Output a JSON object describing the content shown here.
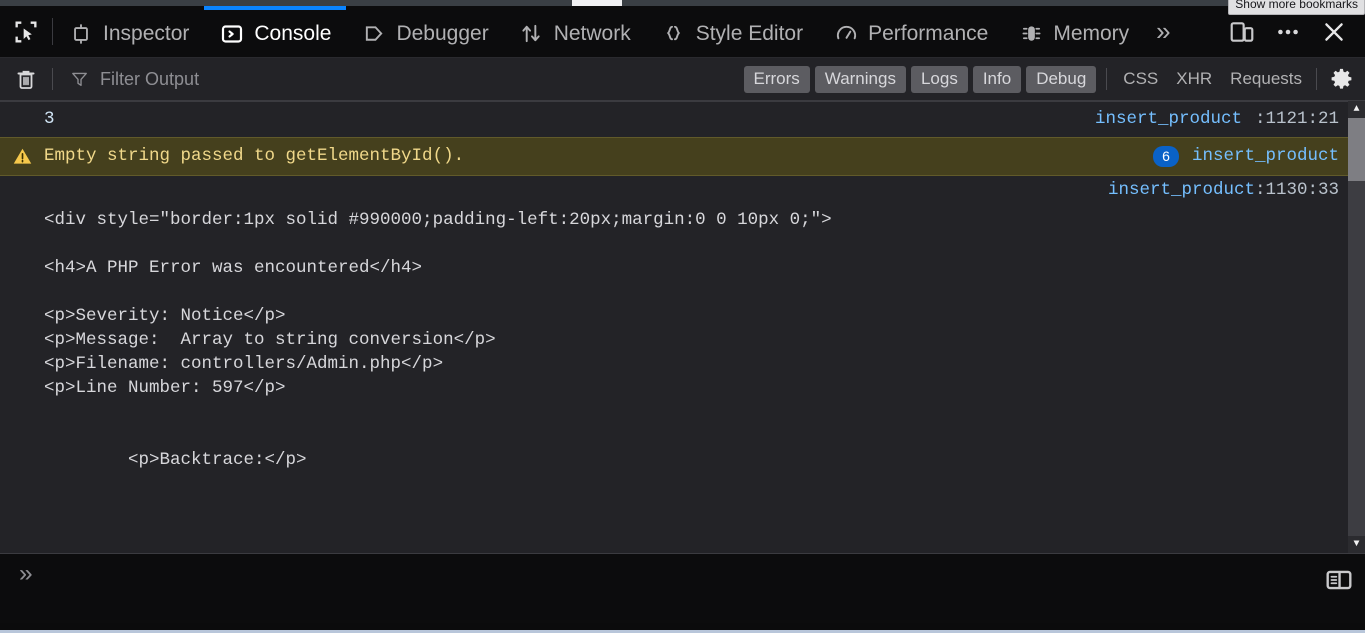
{
  "browser": {
    "bookmarks_tooltip": "Show more bookmarks"
  },
  "devtools": {
    "picker_icon": "element-picker-icon",
    "tabs": [
      {
        "label": "Inspector",
        "icon": "inspector-icon",
        "active": false
      },
      {
        "label": "Console",
        "icon": "console-icon",
        "active": true
      },
      {
        "label": "Debugger",
        "icon": "debugger-icon",
        "active": false
      },
      {
        "label": "Network",
        "icon": "network-icon",
        "active": false
      },
      {
        "label": "Style Editor",
        "icon": "style-editor-icon",
        "active": false
      },
      {
        "label": "Performance",
        "icon": "performance-icon",
        "active": false
      },
      {
        "label": "Memory",
        "icon": "memory-icon",
        "active": false
      }
    ],
    "overflow_chevron": "»",
    "responsive_mode_icon": "responsive-design-mode-icon",
    "meatball_icon": "more-options-icon",
    "close_icon": "close-icon",
    "accent_color": "#0a84ff"
  },
  "filter_bar": {
    "clear_icon": "trash-icon",
    "filter_icon": "funnel-icon",
    "filter_placeholder": "Filter Output",
    "filter_value": "",
    "severity_buttons": [
      {
        "label": "Errors",
        "active": true
      },
      {
        "label": "Warnings",
        "active": true
      },
      {
        "label": "Logs",
        "active": true
      },
      {
        "label": "Info",
        "active": true
      },
      {
        "label": "Debug",
        "active": true
      }
    ],
    "category_buttons": [
      {
        "label": "CSS",
        "active": false
      },
      {
        "label": "XHR",
        "active": false
      },
      {
        "label": "Requests",
        "active": false
      }
    ],
    "settings_icon": "gear-icon"
  },
  "console": {
    "messages": [
      {
        "kind": "result",
        "text": "3",
        "source_link": "insert_product:1121:21",
        "source_name": "insert_product",
        "source_lineno": ":1121:21"
      },
      {
        "kind": "warning",
        "icon": "warning-triangle-icon",
        "text": "Empty string passed to getElementById().",
        "repeat_count": "6",
        "source_link": "insert_product",
        "source_name": "insert_product",
        "source_lineno": ""
      }
    ],
    "log_source_link": "insert_product:1130:33",
    "log_source_name": "insert_product",
    "log_source_lineno": ":1130:33",
    "log_text": "<div style=\"border:1px solid #990000;padding-left:20px;margin:0 0 10px 0;\">\n\n<h4>A PHP Error was encountered</h4>\n\n<p>Severity: Notice</p>\n<p>Message:  Array to string conversion</p>\n<p>Filename: controllers/Admin.php</p>\n<p>Line Number: 597</p>\n\n\n        <p>Backtrace:</p>",
    "scrollbar": {
      "up_arrow": "▲",
      "down_arrow": "▼"
    }
  },
  "input_bar": {
    "prompt": "»",
    "value": "",
    "split_console_icon": "split-console-icon"
  }
}
